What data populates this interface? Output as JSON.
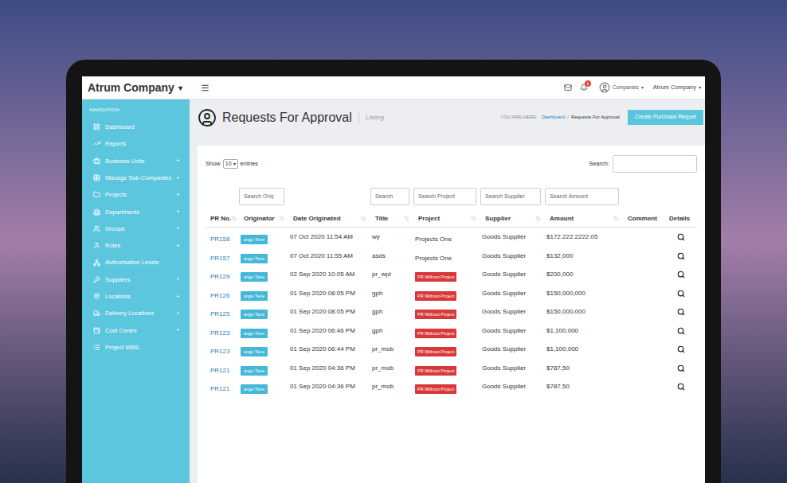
{
  "top_bar": {
    "brand": "Atrum Company",
    "brand_caret": "▾",
    "notification_count": "1",
    "companies_label": "Companies",
    "companies_caret": "▾",
    "account_label": "Atrum Company",
    "account_caret": "▾"
  },
  "sidebar": {
    "heading": "NAVIGATION",
    "expand_glyph": "+",
    "items": [
      {
        "label": "Dashboard",
        "expandable": false
      },
      {
        "label": "Reports",
        "expandable": false
      },
      {
        "label": "Business Units",
        "expandable": true
      },
      {
        "label": "Manage Sub-Companies",
        "expandable": true
      },
      {
        "label": "Projects",
        "expandable": true
      },
      {
        "label": "Departments",
        "expandable": true
      },
      {
        "label": "Groups",
        "expandable": true
      },
      {
        "label": "Roles",
        "expandable": true
      },
      {
        "label": "Authorisation Levels",
        "expandable": false
      },
      {
        "label": "Suppliers",
        "expandable": true
      },
      {
        "label": "Locations",
        "expandable": true
      },
      {
        "label": "Delivery Locations",
        "expandable": true
      },
      {
        "label": "Cost Centre",
        "expandable": true
      },
      {
        "label": "Project WBS",
        "expandable": false
      }
    ]
  },
  "page_header": {
    "title": "Requests For Approval",
    "subtitle": "Listing",
    "breadcrumb_prefix": "YOU ARE HERE:",
    "breadcrumb_separator": "/",
    "breadcrumb": [
      {
        "label": "Dashboard",
        "link": true
      },
      {
        "label": "Requests For Approval",
        "link": false
      }
    ],
    "action_button": "Create Purchase Requet"
  },
  "table_controls": {
    "show_label": "Show",
    "page_size": "10",
    "page_size_caret": "▾",
    "entries_label": "entries",
    "search_label": "Search:"
  },
  "table": {
    "columns": [
      {
        "label": "PR No.",
        "sortable": true
      },
      {
        "label": "Originator",
        "sortable": true
      },
      {
        "label": "Date Originated",
        "sortable": true
      },
      {
        "label": "Title",
        "sortable": true
      },
      {
        "label": "Project",
        "sortable": true
      },
      {
        "label": "Supplier",
        "sortable": true
      },
      {
        "label": "Amount",
        "sortable": true
      },
      {
        "label": "Comment",
        "sortable": false
      },
      {
        "label": "Details",
        "sortable": false
      }
    ],
    "filters": [
      {
        "column": "Originator",
        "placeholder": "Search Orig"
      },
      {
        "column": "Title",
        "placeholder": "Search"
      },
      {
        "column": "Project",
        "placeholder": "Search Project"
      },
      {
        "column": "Supplier",
        "placeholder": "Search Supplier"
      },
      {
        "column": "Amount",
        "placeholder": "Search Amount"
      }
    ],
    "rows": [
      {
        "pr": "PR158",
        "originator": "ange Tiere",
        "date": "07 Oct 2020 11:54 AM",
        "title": "wy",
        "project": {
          "label": "Projects One",
          "kind": "text"
        },
        "supplier": "Goods Supplier",
        "amount": "$172.222.2222.05"
      },
      {
        "pr": "PR157",
        "originator": "ange Tiere",
        "date": "07 Oct 2020 11:55 AM",
        "title": "asds",
        "project": {
          "label": "Projects One",
          "kind": "text"
        },
        "supplier": "Goods Supplier",
        "amount": "$132,000"
      },
      {
        "pr": "PR129",
        "originator": "ange Tiere",
        "date": "02 Sep 2020 10:05 AM",
        "title": "pr_wpt",
        "project": {
          "label": "PR Without Project",
          "kind": "badge"
        },
        "supplier": "Goods Supplier",
        "amount": "$200,000"
      },
      {
        "pr": "PR126",
        "originator": "ange Tiere",
        "date": "01 Sep 2020 08:05 PM",
        "title": "gph",
        "project": {
          "label": "PR Without Project",
          "kind": "badge"
        },
        "supplier": "Goods Supplier",
        "amount": "$150,000,000"
      },
      {
        "pr": "PR125",
        "originator": "ange Tiere",
        "date": "01 Sep 2020 08:05 PM",
        "title": "gph",
        "project": {
          "label": "PR Without Project",
          "kind": "badge"
        },
        "supplier": "Goods Supplier",
        "amount": "$150,000,000"
      },
      {
        "pr": "PR123",
        "originator": "ange Tiere",
        "date": "01 Sep 2020 06:46 PM",
        "title": "gph",
        "project": {
          "label": "PR Without Project",
          "kind": "badge"
        },
        "supplier": "Goods Supplier",
        "amount": "$1,100,000"
      },
      {
        "pr": "PR123",
        "originator": "ange Tiere",
        "date": "01 Sep 2020 06:44 PM",
        "title": "pr_mob",
        "project": {
          "label": "PR Without Project",
          "kind": "badge"
        },
        "supplier": "Goods Supplier",
        "amount": "$1,100,000"
      },
      {
        "pr": "PR121",
        "originator": "ange Tiere",
        "date": "01 Sep 2020 04:36 PM",
        "title": "pr_mob",
        "project": {
          "label": "PR Without Project",
          "kind": "badge"
        },
        "supplier": "Goods Supplier",
        "amount": "$787,50"
      },
      {
        "pr": "PR121",
        "originator": "ange Tiere",
        "date": "01 Sep 2020 04:36 PM",
        "title": "pr_mob",
        "project": {
          "label": "PR Without Project",
          "kind": "badge"
        },
        "supplier": "Goods Supplier",
        "amount": "$787,50"
      }
    ]
  }
}
